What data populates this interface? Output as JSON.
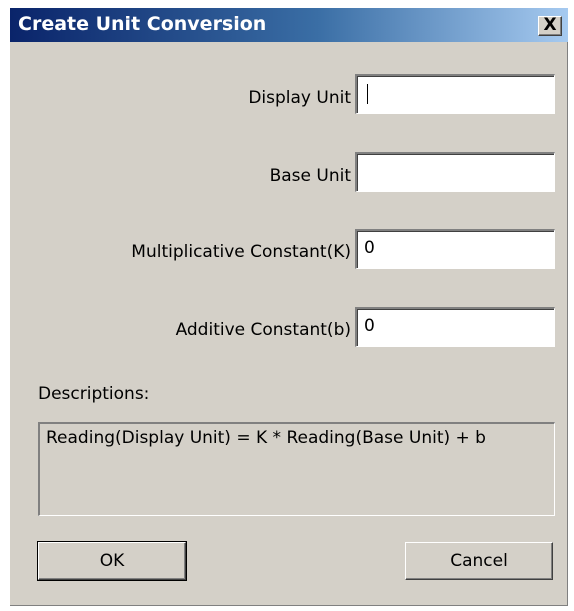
{
  "window": {
    "title": "Create Unit Conversion",
    "close_label": "X"
  },
  "fields": {
    "display_unit": {
      "label": "Display Unit",
      "value": ""
    },
    "base_unit": {
      "label": "Base Unit",
      "value": ""
    },
    "multiplicative_constant": {
      "label": "Multiplicative Constant(K)",
      "value": "0"
    },
    "additive_constant": {
      "label": "Additive Constant(b)",
      "value": "0"
    }
  },
  "descriptions": {
    "label": "Descriptions:",
    "text": "Reading(Display Unit) = K * Reading(Base Unit) + b"
  },
  "buttons": {
    "ok": "OK",
    "cancel": "Cancel"
  },
  "colors": {
    "dialog_background": "#d4d0c8",
    "titlebar_start": "#0a246a",
    "titlebar_end": "#a6caf0"
  }
}
